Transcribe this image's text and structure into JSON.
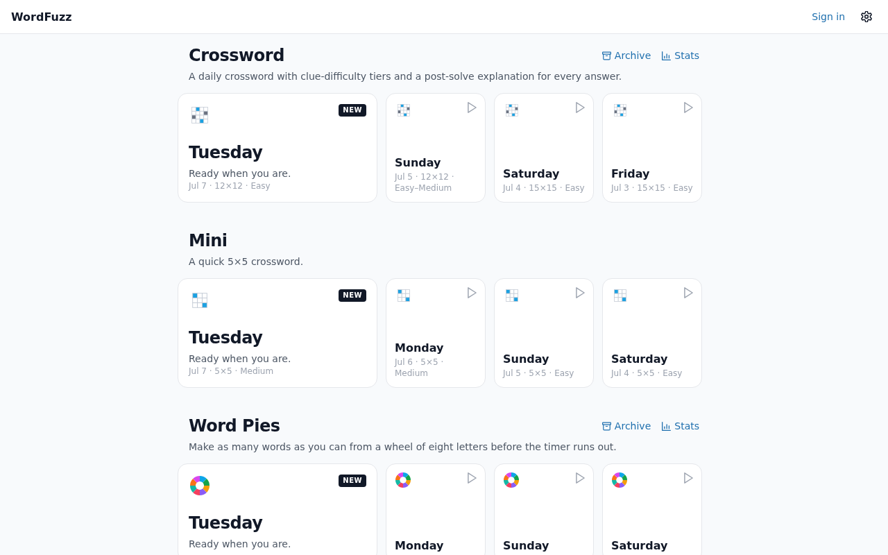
{
  "header": {
    "brand": "WordFuzz",
    "sign_in": "Sign in"
  },
  "sections": [
    {
      "title": "Crossword",
      "kind": "crossword",
      "description": "A daily crossword with clue-difficulty tiers and a post-solve explanation for every answer.",
      "links": [
        {
          "label": "Archive",
          "kind": "archive"
        },
        {
          "label": "Stats",
          "kind": "stats"
        }
      ],
      "cards": [
        {
          "kind": "featured",
          "day": "Tuesday",
          "badge": "NEW",
          "tagline": "Ready when you are.",
          "meta": "Jul 7 · 12×12 · Easy"
        },
        {
          "kind": "compact",
          "day": "Sunday",
          "meta": "Jul 5 · 12×12 · Easy–Medium"
        },
        {
          "kind": "compact",
          "day": "Saturday",
          "meta": "Jul 4 · 15×15 · Easy"
        },
        {
          "kind": "compact",
          "day": "Friday",
          "meta": "Jul 3 · 15×15 · Easy"
        }
      ]
    },
    {
      "title": "Mini",
      "kind": "mini",
      "description": "A quick 5×5 crossword.",
      "cards": [
        {
          "kind": "featured",
          "day": "Tuesday",
          "badge": "NEW",
          "tagline": "Ready when you are.",
          "meta": "Jul 7 · 5×5 · Medium"
        },
        {
          "kind": "compact",
          "day": "Monday",
          "meta": "Jul 6 · 5×5 · Medium"
        },
        {
          "kind": "compact",
          "day": "Sunday",
          "meta": "Jul 5 · 5×5 · Easy"
        },
        {
          "kind": "compact",
          "day": "Saturday",
          "meta": "Jul 4 · 5×5 · Easy"
        }
      ]
    },
    {
      "title": "Word Pies",
      "kind": "pie",
      "description": "Make as many words as you can from a wheel of eight letters before the timer runs out.",
      "links": [
        {
          "label": "Archive",
          "kind": "archive"
        },
        {
          "label": "Stats",
          "kind": "stats"
        }
      ],
      "cards": [
        {
          "kind": "featured",
          "day": "Tuesday",
          "badge": "NEW",
          "tagline": "Ready when you are."
        },
        {
          "kind": "compact",
          "day": "Monday"
        },
        {
          "kind": "compact",
          "day": "Sunday"
        },
        {
          "kind": "compact",
          "day": "Saturday"
        }
      ]
    }
  ]
}
